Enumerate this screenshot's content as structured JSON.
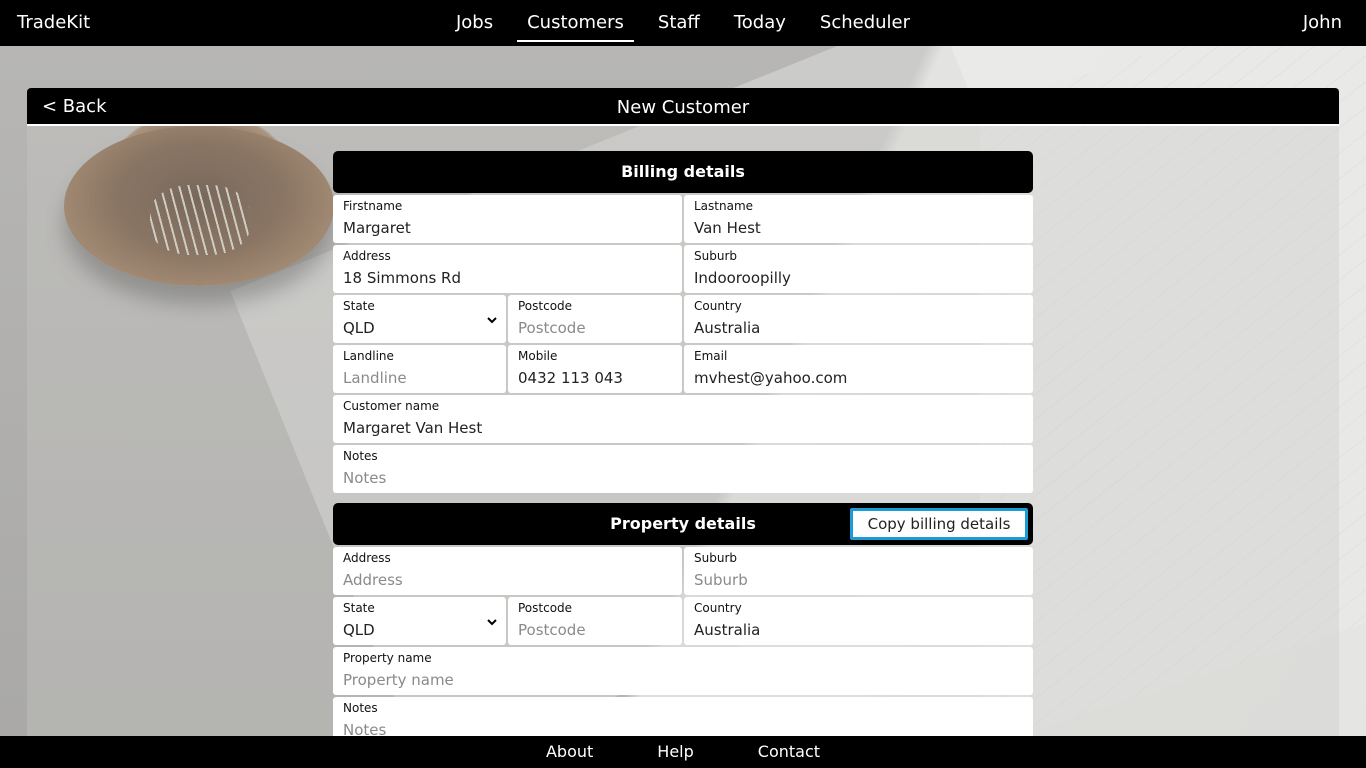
{
  "app": {
    "brand": "TradeKit",
    "user": "John"
  },
  "nav": {
    "items": [
      {
        "label": "Jobs"
      },
      {
        "label": "Customers",
        "active": true
      },
      {
        "label": "Staff"
      },
      {
        "label": "Today"
      },
      {
        "label": "Scheduler"
      }
    ]
  },
  "panel": {
    "back_label": "< Back",
    "title": "New Customer"
  },
  "billing": {
    "title": "Billing details",
    "firstname": {
      "label": "Firstname",
      "value": "Margaret",
      "placeholder": "Firstname"
    },
    "lastname": {
      "label": "Lastname",
      "value": "Van Hest",
      "placeholder": "Lastname"
    },
    "address": {
      "label": "Address",
      "value": "18 Simmons Rd",
      "placeholder": "Address"
    },
    "suburb": {
      "label": "Suburb",
      "value": "Indooroopilly",
      "placeholder": "Suburb"
    },
    "state": {
      "label": "State",
      "value": "QLD"
    },
    "postcode": {
      "label": "Postcode",
      "value": "",
      "placeholder": "Postcode"
    },
    "country": {
      "label": "Country",
      "value": "Australia",
      "placeholder": "Country"
    },
    "landline": {
      "label": "Landline",
      "value": "",
      "placeholder": "Landline"
    },
    "mobile": {
      "label": "Mobile",
      "value": "0432 113 043",
      "placeholder": "Mobile"
    },
    "email": {
      "label": "Email",
      "value": "mvhest@yahoo.com",
      "placeholder": "Email"
    },
    "customer_name": {
      "label": "Customer name",
      "value": "Margaret Van Hest",
      "placeholder": "Customer name"
    },
    "notes": {
      "label": "Notes",
      "value": "",
      "placeholder": "Notes"
    }
  },
  "property": {
    "title": "Property details",
    "copy_label": "Copy billing details",
    "address": {
      "label": "Address",
      "value": "",
      "placeholder": "Address"
    },
    "suburb": {
      "label": "Suburb",
      "value": "",
      "placeholder": "Suburb"
    },
    "state": {
      "label": "State",
      "value": "QLD"
    },
    "postcode": {
      "label": "Postcode",
      "value": "",
      "placeholder": "Postcode"
    },
    "country": {
      "label": "Country",
      "value": "Australia",
      "placeholder": "Country"
    },
    "property_name": {
      "label": "Property name",
      "value": "",
      "placeholder": "Property name"
    },
    "notes": {
      "label": "Notes",
      "value": "",
      "placeholder": "Notes"
    }
  },
  "footer": {
    "items": [
      {
        "label": "About"
      },
      {
        "label": "Help"
      },
      {
        "label": "Contact"
      }
    ]
  },
  "colors": {
    "accent": "#1d9bd6",
    "bar": "#000000"
  }
}
